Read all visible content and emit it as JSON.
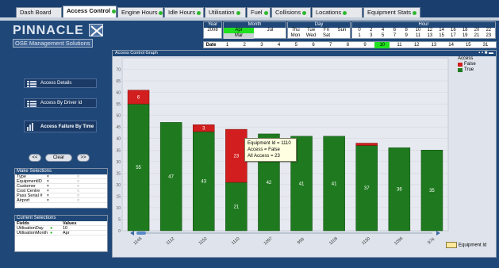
{
  "tabs": [
    {
      "label": "Dash Board",
      "dot": false,
      "active": false
    },
    {
      "label": "Access Control",
      "dot": true,
      "active": true
    },
    {
      "label": "Engine Hours",
      "dot": true,
      "active": false
    },
    {
      "label": "Idle Hours",
      "dot": true,
      "active": false
    },
    {
      "label": "Utilisation",
      "dot": true,
      "active": false
    },
    {
      "label": "Fuel",
      "dot": true,
      "active": false
    },
    {
      "label": "Collisions",
      "dot": true,
      "active": false
    },
    {
      "label": "Locations",
      "dot": true,
      "active": false
    },
    {
      "label": "Equipment Stats",
      "dot": true,
      "active": false
    }
  ],
  "logo": {
    "name": "PINNACLE",
    "sub": "OSE Management Solutions"
  },
  "date_selector": {
    "year_label": "Year",
    "year": "2008",
    "month_label": "Month",
    "months": [
      "Apr",
      "Jul",
      "Mar"
    ],
    "selected_month": "Apr",
    "day_label": "Day",
    "days_row1": [
      "Thu",
      "Tue",
      "Fri",
      "Sun"
    ],
    "days_row2": [
      "Mon",
      "Wed",
      "Sat"
    ],
    "hour_label": "Hour",
    "hours_row1": [
      "0",
      "2",
      "4",
      "6",
      "8",
      "10",
      "12",
      "14",
      "16",
      "18",
      "20",
      "22"
    ],
    "hours_row2": [
      "1",
      "3",
      "5",
      "7",
      "9",
      "11",
      "13",
      "15",
      "17",
      "19",
      "21",
      "23"
    ],
    "date_label": "Date",
    "dates": [
      "1",
      "2",
      "3",
      "4",
      "5",
      "6",
      "7",
      "8",
      "9",
      "10",
      "11",
      "12",
      "13",
      "14",
      "15",
      "31"
    ],
    "selected_date": "10"
  },
  "nav": {
    "access_details": "Access Details",
    "access_by_driver": "Access By Driver Id",
    "access_failure_by_time": "Access Failure By Time"
  },
  "pager": {
    "prev": "<<",
    "clear": "Clear",
    "next": ">>"
  },
  "make_selections": {
    "title": "Make Selections",
    "rows": [
      "Type",
      "EquipmentID",
      "Customer",
      "Cost Centre",
      "Pass Serial #",
      "Airport"
    ]
  },
  "current_selections": {
    "title": "Current Selections",
    "fields_header": "Fields",
    "values_header": "Values",
    "rows": [
      {
        "field": "UtilisationDay",
        "value": "10"
      },
      {
        "field": "UtilisationMonth",
        "value": "Apr"
      }
    ]
  },
  "chart_title": "Access Control Graph",
  "legend": {
    "title": "Access",
    "false_label": "False",
    "true_label": "True"
  },
  "tooltip": {
    "line1": "Equipment Id = 1110",
    "line2": "Access = False",
    "line3": "All Access = 23"
  },
  "x_axis_label": "Equipment Id",
  "colors": {
    "true": "#1f7a1f",
    "false": "#d21e1e",
    "selected_date": "#20e020"
  },
  "chart_data": {
    "type": "bar",
    "stacked": true,
    "categories": [
      "1145",
      "1112",
      "1152",
      "1110",
      "1097",
      "999",
      "1108",
      "1150",
      "1096",
      "976"
    ],
    "series": [
      {
        "name": "True",
        "values": [
          55,
          47,
          43,
          21,
          42,
          41,
          41,
          37,
          36,
          35
        ]
      },
      {
        "name": "False",
        "values": [
          6,
          0,
          3,
          23,
          0,
          0,
          0,
          1,
          0,
          0
        ]
      }
    ],
    "yticks": [
      "70",
      "65",
      "60",
      "55",
      "50",
      "45",
      "40",
      "35",
      "30",
      "25",
      "20",
      "15",
      "10",
      "5",
      "0"
    ],
    "ylim": [
      0,
      75
    ],
    "grid": true,
    "legend_position": "top-right"
  }
}
